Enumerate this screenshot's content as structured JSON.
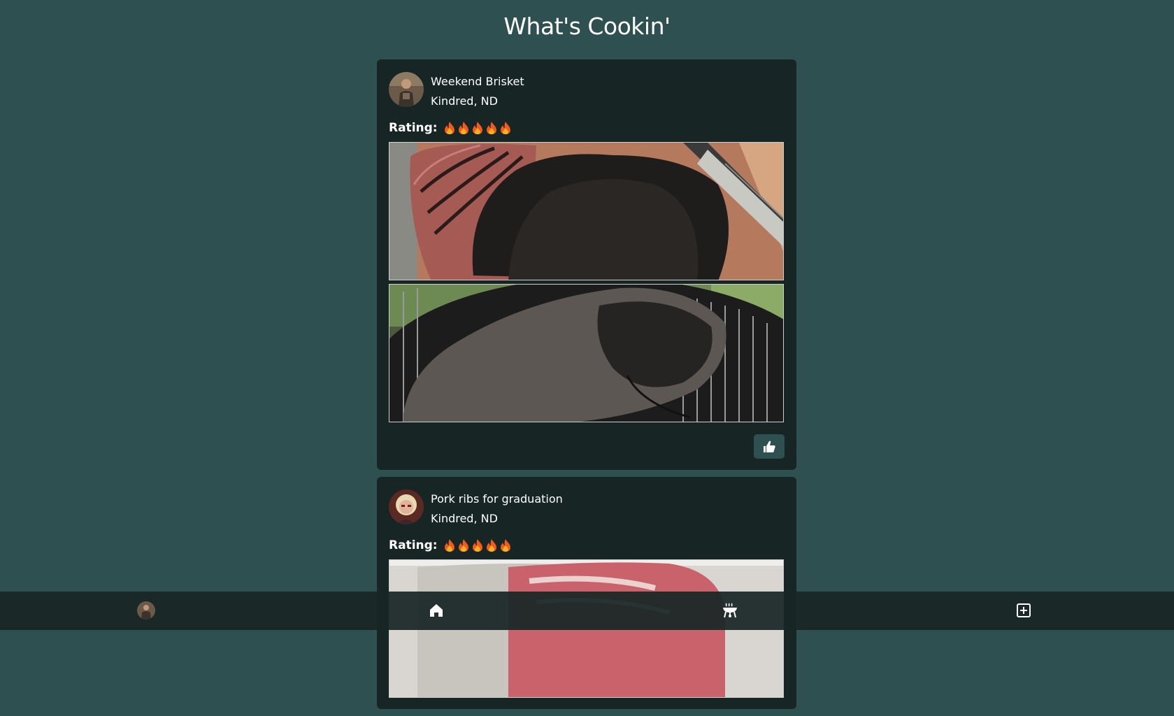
{
  "app": {
    "title": "What's Cookin'"
  },
  "posts": [
    {
      "title": "Weekend Brisket",
      "location": "Kindred, ND",
      "rating_label": "Rating:",
      "rating": 5,
      "rating_icon": "fire-emoji",
      "photos": [
        "sliced-brisket-photo",
        "brisket-on-grill-photo"
      ],
      "like_icon": "thumbs-up-icon"
    },
    {
      "title": "Pork ribs for graduation",
      "location": "Kindred, ND",
      "rating_label": "Rating:",
      "rating": 5,
      "rating_icon": "fire-emoji",
      "photos": [
        "raw-pork-ribs-photo"
      ]
    }
  ],
  "nav": {
    "items": [
      "profile-avatar",
      "home-icon",
      "grill-icon",
      "add-post-icon"
    ]
  },
  "colors": {
    "background": "#2e5050",
    "card": "#172525",
    "nav": "#192626",
    "button": "#2e5050"
  }
}
